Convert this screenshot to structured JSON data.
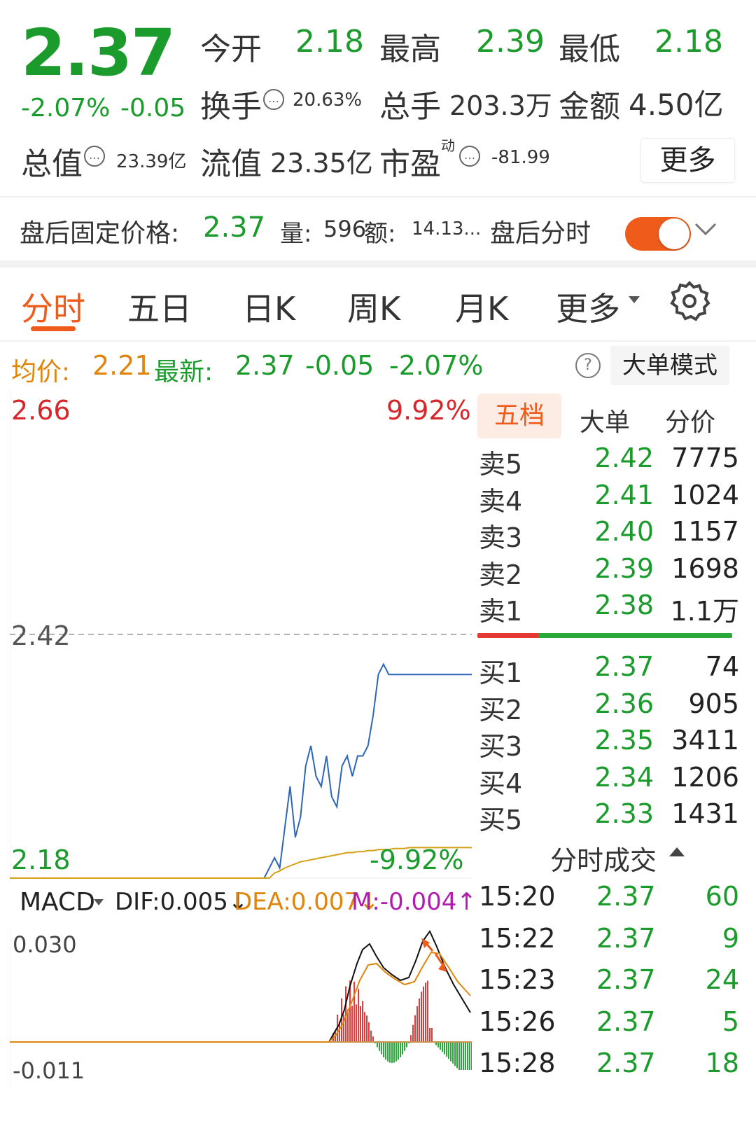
{
  "quote": {
    "price": "2.37",
    "change_pct": "-2.07%",
    "change": "-0.05",
    "open_label": "今开",
    "open": "2.18",
    "high_label": "最高",
    "high": "2.39",
    "low_label": "最低",
    "low": "2.18",
    "turnover_label": "换手",
    "turnover": "20.63%",
    "volume_label": "总手",
    "volume": "203.3万",
    "amount_label": "金额",
    "amount": "4.50亿",
    "mcap_label": "总值",
    "mcap": "23.39亿",
    "float_label": "流值",
    "float_mcap": "23.35亿",
    "pe_label": "市盈",
    "pe_sup": "动",
    "pe": "-81.99",
    "more_label": "更多"
  },
  "after_hours": {
    "label": "盘后固定价格:",
    "price": "2.37",
    "vol_label": "量:",
    "vol": "596",
    "amt_label": "额:",
    "amt": "14.13...",
    "toggle_label": "盘后分时",
    "toggle_on": true
  },
  "tabs": [
    "分时",
    "五日",
    "日K",
    "周K",
    "月K",
    "更多"
  ],
  "active_tab": "分时",
  "chart_header": {
    "avg_label": "均价:",
    "avg": "2.21",
    "latest_label": "最新:",
    "latest": "2.37",
    "change": "-0.05",
    "change_pct": "-2.07%",
    "mode_label": "大单模式"
  },
  "order_book": {
    "tabs": [
      "五档",
      "大单",
      "分价"
    ],
    "asks": [
      {
        "label": "卖5",
        "price": "2.42",
        "vol": "7775"
      },
      {
        "label": "卖4",
        "price": "2.41",
        "vol": "1024"
      },
      {
        "label": "卖3",
        "price": "2.40",
        "vol": "1157"
      },
      {
        "label": "卖2",
        "price": "2.39",
        "vol": "1698"
      },
      {
        "label": "卖1",
        "price": "2.38",
        "vol": "1.1万"
      }
    ],
    "bids": [
      {
        "label": "买1",
        "price": "2.37",
        "vol": "74"
      },
      {
        "label": "买2",
        "price": "2.36",
        "vol": "905"
      },
      {
        "label": "买3",
        "price": "2.35",
        "vol": "3411"
      },
      {
        "label": "买4",
        "price": "2.34",
        "vol": "1206"
      },
      {
        "label": "买5",
        "price": "2.33",
        "vol": "1431"
      }
    ]
  },
  "trades": {
    "title": "分时成交",
    "rows": [
      {
        "time": "15:20",
        "price": "2.37",
        "vol": "60"
      },
      {
        "time": "15:22",
        "price": "2.37",
        "vol": "9"
      },
      {
        "time": "15:23",
        "price": "2.37",
        "vol": "24"
      },
      {
        "time": "15:26",
        "price": "2.37",
        "vol": "5"
      },
      {
        "time": "15:28",
        "price": "2.37",
        "vol": "18"
      }
    ]
  },
  "macd": {
    "name": "MACD",
    "dif": "DIF:0.005",
    "dea": "DEA:0.007",
    "m": "M:-0.004",
    "top": "0.030",
    "bottom": "-0.011"
  },
  "chart_data": {
    "type": "line",
    "y_top": "2.66",
    "y_top_pct": "9.92%",
    "y_bottom": "2.18",
    "y_bottom_pct": "-9.92%",
    "ref_price": "2.42",
    "ylim": [
      2.18,
      2.66
    ],
    "series": [
      {
        "values": [
          2.18,
          2.18,
          2.18,
          2.18,
          2.18,
          2.18,
          2.18,
          2.18,
          2.18,
          2.18,
          2.18,
          2.18,
          2.18,
          2.18,
          2.18,
          2.18,
          2.18,
          2.18,
          2.18,
          2.18,
          2.18,
          2.18,
          2.18,
          2.18,
          2.18,
          2.18,
          2.18,
          2.18,
          2.18,
          2.18,
          2.18,
          2.18,
          2.18,
          2.18,
          2.18,
          2.18,
          2.18,
          2.18,
          2.18,
          2.18,
          2.18,
          2.18,
          2.18,
          2.18,
          2.18,
          2.18,
          2.18,
          2.18,
          2.18,
          2.18,
          2.19,
          2.2,
          2.19,
          2.23,
          2.27,
          2.22,
          2.24,
          2.29,
          2.31,
          2.28,
          2.27,
          2.3,
          2.26,
          2.25,
          2.29,
          2.3,
          2.28,
          2.3,
          2.3,
          2.31,
          2.34,
          2.38,
          2.39,
          2.38,
          2.38,
          2.38,
          2.38,
          2.38,
          2.38,
          2.38,
          2.38,
          2.38,
          2.38,
          2.38,
          2.38,
          2.38,
          2.38,
          2.38,
          2.38,
          2.38
        ]
      },
      {
        "values": [
          2.18,
          2.18,
          2.18,
          2.18,
          2.18,
          2.18,
          2.18,
          2.18,
          2.18,
          2.18,
          2.18,
          2.18,
          2.18,
          2.18,
          2.18,
          2.18,
          2.18,
          2.18,
          2.18,
          2.18,
          2.18,
          2.18,
          2.18,
          2.18,
          2.18,
          2.18,
          2.18,
          2.18,
          2.18,
          2.18,
          2.18,
          2.18,
          2.18,
          2.18,
          2.18,
          2.18,
          2.18,
          2.18,
          2.18,
          2.18,
          2.18,
          2.18,
          2.18,
          2.18,
          2.18,
          2.18,
          2.18,
          2.18,
          2.18,
          2.18,
          2.18,
          2.185,
          2.187,
          2.19,
          2.192,
          2.194,
          2.196,
          2.197,
          2.198,
          2.199,
          2.2,
          2.201,
          2.202,
          2.203,
          2.204,
          2.205,
          2.205,
          2.206,
          2.206,
          2.207,
          2.207,
          2.208,
          2.208,
          2.208,
          2.209,
          2.209,
          2.209,
          2.21,
          2.21,
          2.21,
          2.21,
          2.21,
          2.21,
          2.21,
          2.21,
          2.21,
          2.21,
          2.21,
          2.21,
          2.21
        ]
      }
    ]
  }
}
